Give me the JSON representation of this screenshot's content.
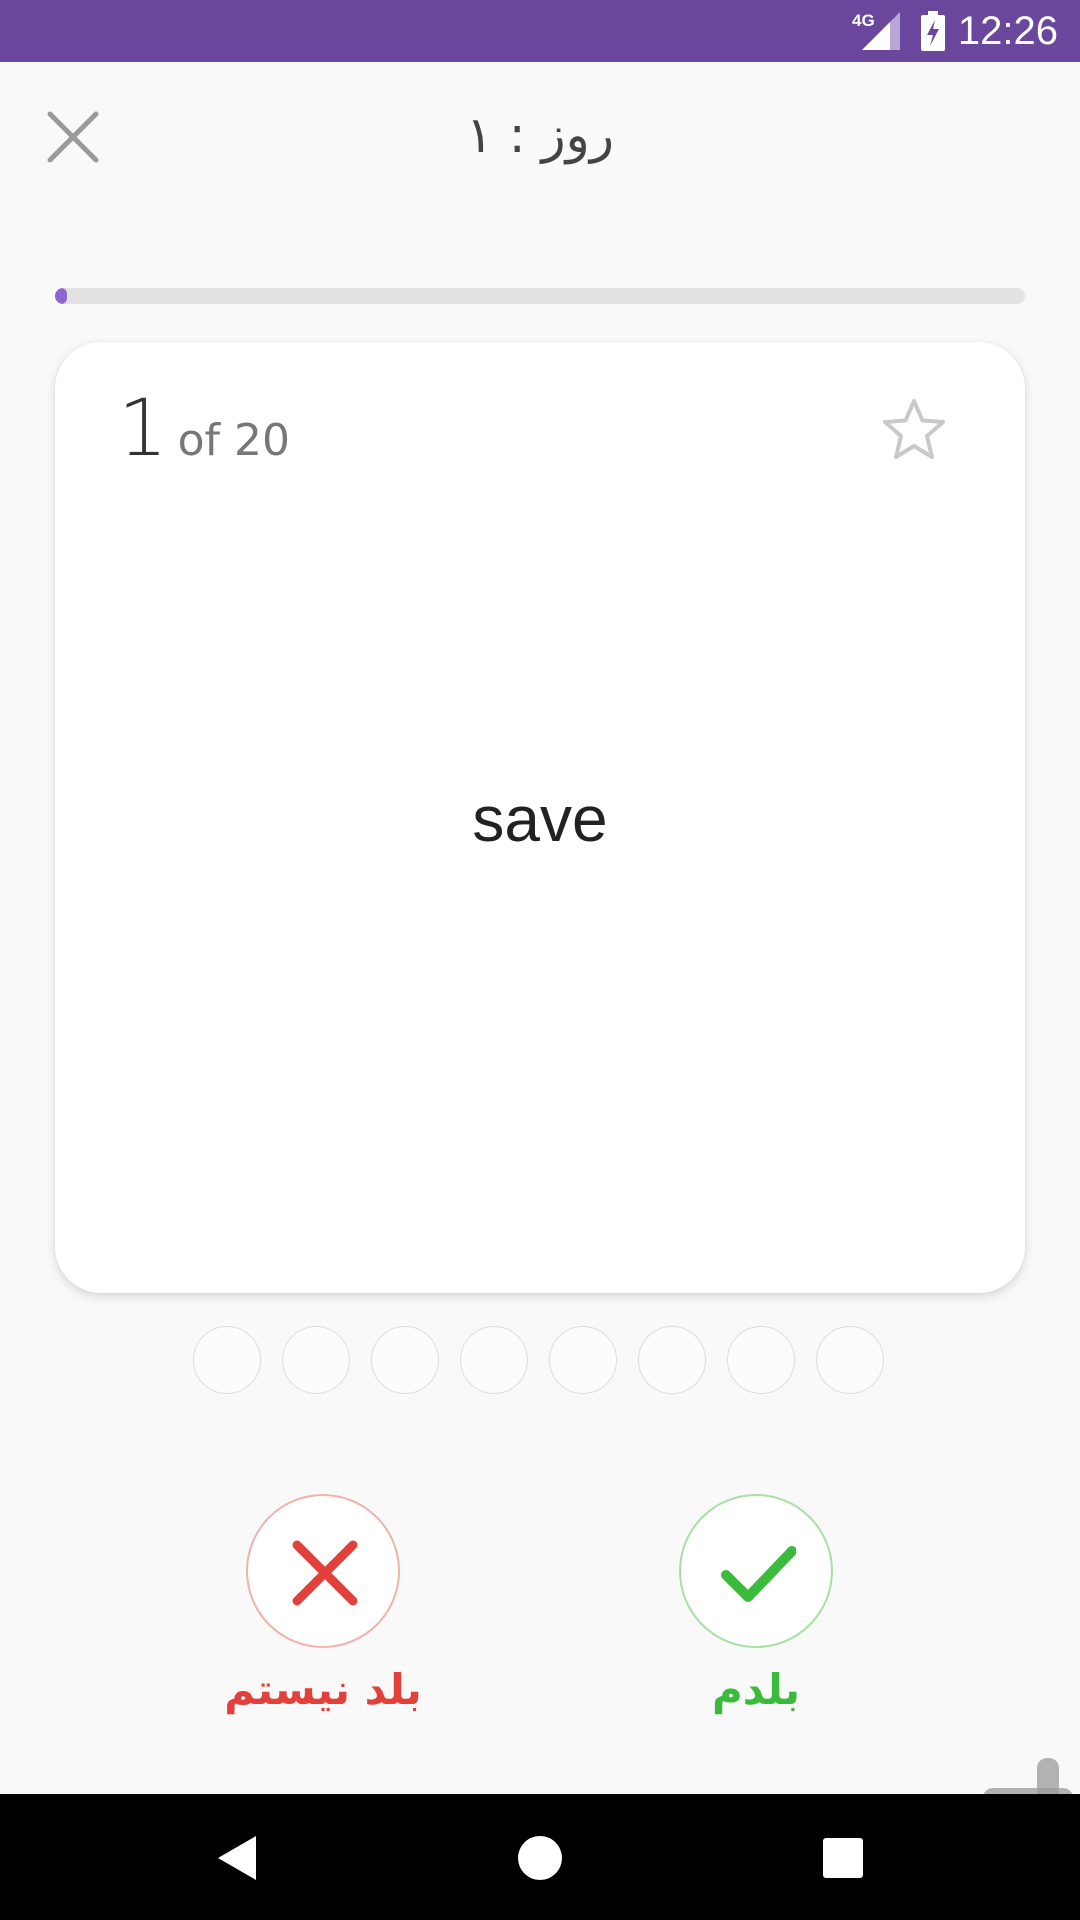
{
  "status_bar": {
    "network": "4G",
    "time": "12:26",
    "background_color": "#6a479c"
  },
  "header": {
    "title": "روز : ۱",
    "close_icon": "close-icon"
  },
  "progress": {
    "current": 1,
    "total": 20,
    "fraction": 0.012,
    "color": "#8d66cf"
  },
  "card": {
    "current": "1",
    "of_text": "of 20",
    "word": "save",
    "star_icon": "star-outline-icon"
  },
  "dots": {
    "count": 8
  },
  "actions": {
    "dont_know_label": "بلد نیستم",
    "know_label": "بلدم",
    "dont_know_color": "#e2403b",
    "know_color": "#3bbb3b"
  },
  "nav_bar": {
    "back_icon": "back-triangle-icon",
    "home_icon": "home-circle-icon",
    "recents_icon": "recents-square-icon"
  }
}
